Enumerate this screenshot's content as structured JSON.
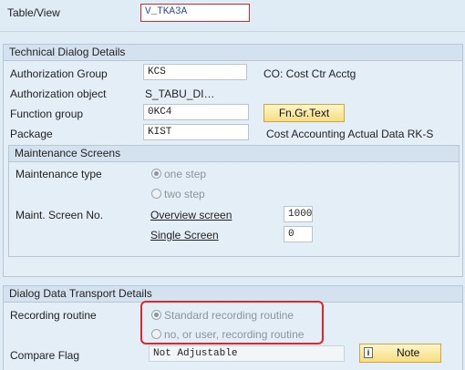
{
  "header": {
    "table_view_label": "Table/View",
    "table_view_value": "V_TKA3A"
  },
  "technical": {
    "title": "Technical Dialog Details",
    "auth_group_label": "Authorization Group",
    "auth_group_value": "KCS",
    "auth_group_desc": "CO: Cost Ctr Acctg",
    "auth_object_label": "Authorization object",
    "auth_object_value": "S_TABU_DI…",
    "function_group_label": "Function group",
    "function_group_value": "0KC4",
    "fn_gr_text_button": "Fn.Gr.Text",
    "package_label": "Package",
    "package_value": "KIST",
    "package_desc": "Cost Accounting Actual Data RK-S"
  },
  "maintenance": {
    "title": "Maintenance Screens",
    "type_label": "Maintenance type",
    "one_step": "one step",
    "two_step": "two step",
    "selected": "one step",
    "screen_no_label": "Maint. Screen No.",
    "overview_label": "Overview screen",
    "overview_value": "1000",
    "single_label": "Single Screen",
    "single_value": "0"
  },
  "transport": {
    "title": "Dialog Data Transport Details",
    "recording_label": "Recording routine",
    "standard": "Standard recording routine",
    "no_user": "no, or user, recording routine",
    "selected": "Standard recording routine",
    "compare_label": "Compare Flag",
    "compare_value": "Not Adjustable",
    "note_button": "Note"
  },
  "colors": {
    "highlight": "#e0262a",
    "button": "#f7dd82"
  }
}
